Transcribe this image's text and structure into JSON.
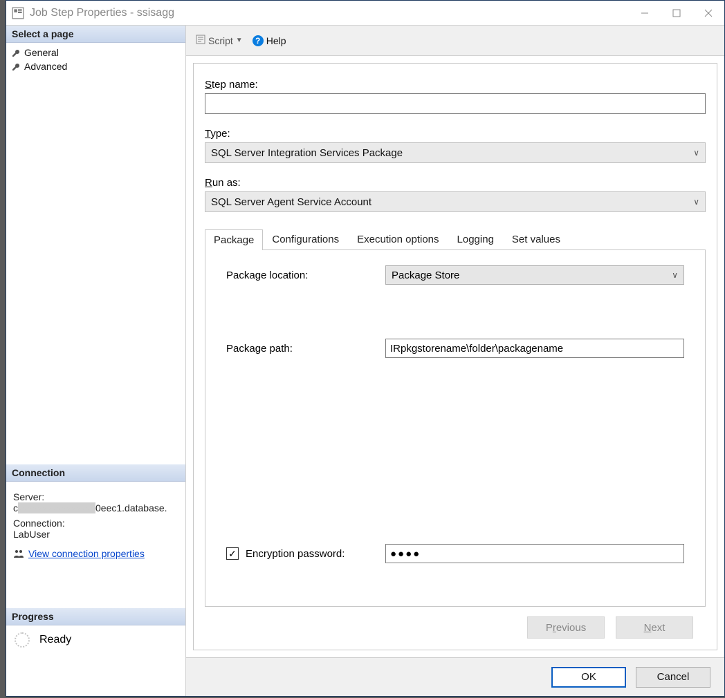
{
  "window": {
    "title": "Job Step Properties - ssisagg"
  },
  "sidebar": {
    "select_header": "Select a page",
    "pages": [
      "General",
      "Advanced"
    ],
    "connection_header": "Connection",
    "server_label": "Server:",
    "server_value_prefix": "c",
    "server_value_suffix": "0eec1.database.",
    "connection_label": "Connection:",
    "connection_value": "LabUser",
    "view_props_link": "View connection properties",
    "progress_header": "Progress",
    "progress_status": "Ready"
  },
  "toolbar": {
    "script": "Script",
    "help": "Help"
  },
  "form": {
    "step_name_label_pre": "S",
    "step_name_label_post": "tep name:",
    "step_name_value": "",
    "type_label_pre": "T",
    "type_label_post": "ype:",
    "type_value": "SQL Server Integration Services Package",
    "runas_label_pre": "R",
    "runas_label_post": "un as:",
    "runas_value": "SQL Server Agent Service Account"
  },
  "tabs": {
    "items": [
      "Package",
      "Configurations",
      "Execution options",
      "Logging",
      "Set values"
    ],
    "active_index": 0
  },
  "package_tab": {
    "location_label": "Package location:",
    "location_value": "Package Store",
    "path_label_pre": "Package pat",
    "path_label_u": "h",
    "path_label_post": ":",
    "path_value": "IRpkgstorename\\folder\\packagename",
    "enc_label_pre": "E",
    "enc_label_post": "ncryption password:",
    "enc_checked": true,
    "enc_value_mask": "●●●●"
  },
  "nav": {
    "prev_pre": "P",
    "prev_u": "r",
    "prev_post": "evious",
    "next_pre": "",
    "next_u": "N",
    "next_post": "ext"
  },
  "footer": {
    "ok": "OK",
    "cancel": "Cancel"
  }
}
